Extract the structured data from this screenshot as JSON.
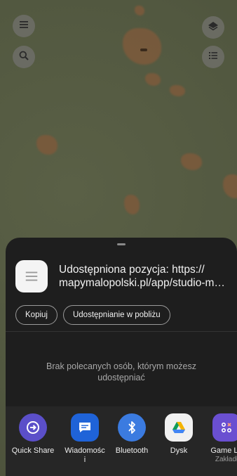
{
  "map": {
    "buttons": [
      {
        "name": "menu",
        "icon": "menu-icon"
      },
      {
        "name": "search",
        "icon": "search-icon"
      },
      {
        "name": "layers",
        "icon": "layers-icon"
      },
      {
        "name": "list",
        "icon": "list-icon"
      }
    ]
  },
  "share_sheet": {
    "preview": {
      "title_line1": "Udostępniona pozycja: https://",
      "title_line2": "mapymalopolski.pl/app/studio-map..."
    },
    "actions": {
      "copy_label": "Kopiuj",
      "nearby_label": "Udostępnianie w pobliżu"
    },
    "empty_message": "Brak polecanych osób, którym możesz udostępniać",
    "apps": [
      {
        "label": "Quick Share",
        "icon": "quick-share-icon",
        "color": "#5b4fc9"
      },
      {
        "label": "Wiadomośc",
        "label2": "i",
        "icon": "messages-icon",
        "color": "#1f63d8"
      },
      {
        "label": "Bluetooth",
        "icon": "bluetooth-icon",
        "color": "#3b7be0"
      },
      {
        "label": "Dysk",
        "icon": "drive-icon",
        "color": "#f1f1f1"
      },
      {
        "label": "Game La",
        "sub": "Zakładł",
        "icon": "game-launcher-icon",
        "color": "#6a4fd1"
      }
    ]
  }
}
